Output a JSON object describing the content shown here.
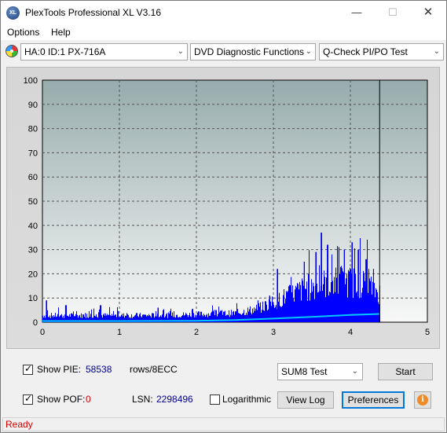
{
  "window": {
    "title": "PlexTools Professional XL V3.16",
    "app_icon_text": "XL",
    "minimize_glyph": "—",
    "maximize_glyph": "☐",
    "close_glyph": "✕"
  },
  "menu": {
    "options_label": "Options",
    "help_label": "Help"
  },
  "toolbar": {
    "drive": "HA:0 ID:1  PX-716A",
    "function": "DVD Diagnostic Functions",
    "test": "Q-Check PI/PO Test",
    "arrow_glyph": "⌄"
  },
  "chart_data": {
    "type": "bar",
    "xlim": [
      0,
      5
    ],
    "ylim": [
      0,
      100
    ],
    "x_ticks": [
      "0",
      "1",
      "2",
      "3",
      "4",
      "5"
    ],
    "y_ticks": [
      "0",
      "10",
      "20",
      "30",
      "40",
      "50",
      "60",
      "70",
      "80",
      "90",
      "100"
    ],
    "grid": true,
    "end_marker_x": 4.38,
    "colors": {
      "plot_background_top": "#97acac",
      "plot_background_bottom": "#f8f8f8",
      "bars": "#0000ff",
      "sum_line": "#00c8ff",
      "grid": "#555555"
    },
    "series": [
      {
        "x_range": [
          0,
          4.38
        ],
        "profile": [
          [
            0.0,
            3
          ],
          [
            0.5,
            3
          ],
          [
            1.0,
            3
          ],
          [
            1.5,
            3
          ],
          [
            2.0,
            3.5
          ],
          [
            2.5,
            4
          ],
          [
            2.8,
            6
          ],
          [
            3.0,
            9
          ],
          [
            3.2,
            12
          ],
          [
            3.4,
            15
          ],
          [
            3.6,
            17
          ],
          [
            3.8,
            18
          ],
          [
            4.0,
            18
          ],
          [
            4.2,
            17
          ],
          [
            4.38,
            13
          ]
        ],
        "peaks": [
          [
            0.05,
            9
          ],
          [
            0.3,
            7
          ],
          [
            0.75,
            7
          ],
          [
            1.5,
            6
          ],
          [
            2.25,
            5
          ],
          [
            2.8,
            9
          ],
          [
            2.95,
            11
          ],
          [
            3.05,
            22
          ],
          [
            3.4,
            25
          ],
          [
            3.55,
            29
          ],
          [
            3.62,
            37
          ],
          [
            3.7,
            32
          ],
          [
            3.85,
            31
          ],
          [
            3.92,
            30
          ],
          [
            4.02,
            33
          ],
          [
            4.1,
            30
          ],
          [
            4.2,
            26
          ],
          [
            4.3,
            22
          ]
        ]
      },
      {
        "name_hidden": true,
        "points": [
          [
            0,
            0.5
          ],
          [
            1,
            0.5
          ],
          [
            2,
            0.6
          ],
          [
            2.5,
            0.9
          ],
          [
            3,
            1.5
          ],
          [
            3.5,
            2.2
          ],
          [
            4,
            3
          ],
          [
            4.38,
            3.4
          ]
        ]
      }
    ]
  },
  "controls": {
    "show_pie_label": "Show PIE:",
    "show_pie_checked": true,
    "pie_value": "58538",
    "pie_unit": "rows/8ECC",
    "show_pof_label": "Show POF:",
    "show_pof_checked": true,
    "pof_value": "0",
    "lsn_label": "LSN:",
    "lsn_value": "2298496",
    "logarithmic_label": "Logarithmic",
    "logarithmic_checked": false,
    "test_select": "SUM8 Test",
    "start_label": "Start",
    "view_log_label": "View Log",
    "preferences_label": "Preferences",
    "info_glyph": "i"
  },
  "status": {
    "text": "Ready"
  }
}
